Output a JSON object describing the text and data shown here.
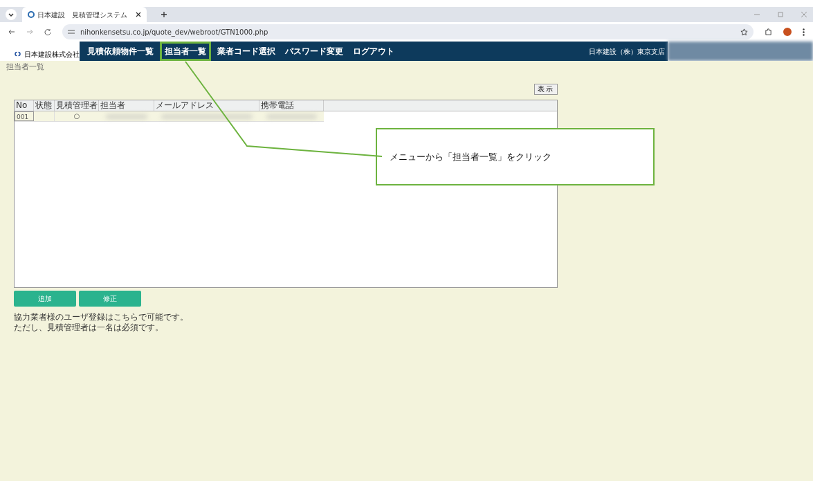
{
  "browser": {
    "tab_title": "日本建設　見積管理システム",
    "url": "nihonkensetsu.co.jp/quote_dev/webroot/GTN1000.php"
  },
  "header": {
    "company": "日本建設株式会社",
    "nav": [
      {
        "label": "見積依頼物件一覧",
        "selected": false
      },
      {
        "label": "担当者一覧",
        "selected": true
      },
      {
        "label": "業者コード選択",
        "selected": false
      },
      {
        "label": "パスワード変更",
        "selected": false
      },
      {
        "label": "ログアウト",
        "selected": false
      }
    ],
    "branch": "日本建設（株）東京支店"
  },
  "page_title": "担当者一覧",
  "show_button": "表示",
  "table": {
    "columns": [
      "No",
      "状態",
      "見積管理者",
      "担当者",
      "メールアドレス",
      "携帯電話"
    ],
    "rows": [
      {
        "no": "001",
        "manager_mark": "○"
      }
    ]
  },
  "buttons": [
    "追加",
    "修正"
  ],
  "notes": [
    "協力業者様のユーザ登録はこちらで可能です。",
    "ただし、見積管理者は一名は必須です。"
  ],
  "callout": "メニューから「担当者一覧」をクリック"
}
